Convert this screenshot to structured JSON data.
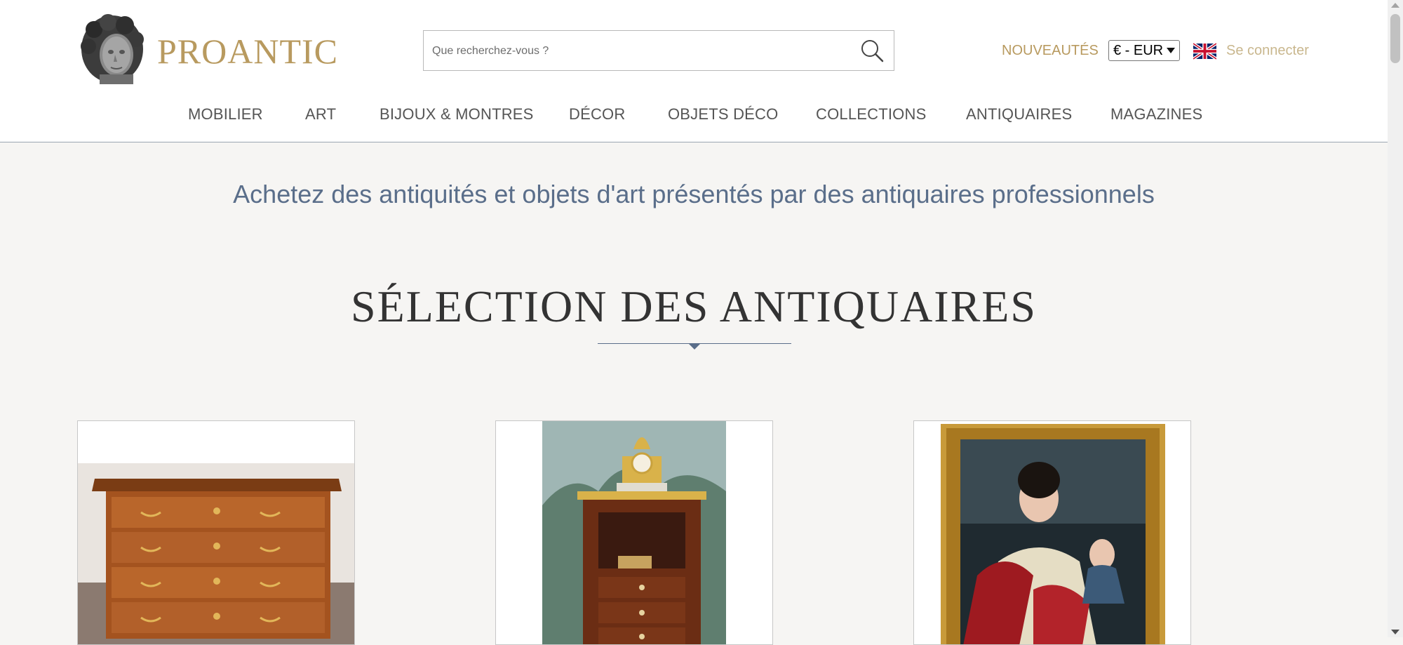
{
  "header": {
    "logo_text": "PROANTIC",
    "search": {
      "placeholder": "Que recherchez-vous ?",
      "value": ""
    },
    "nouveautes_label": "NOUVEAUTÉS",
    "currency_selected": "€ - EUR",
    "login_label": "Se connecter",
    "colors": {
      "gold": "#b89a5f",
      "login": "#c9b78e",
      "nav_text": "#555555"
    }
  },
  "nav": {
    "items": [
      {
        "label": "MOBILIER"
      },
      {
        "label": "ART"
      },
      {
        "label": "BIJOUX & MONTRES"
      },
      {
        "label": "DÉCOR"
      },
      {
        "label": "OBJETS DÉCO"
      },
      {
        "label": "COLLECTIONS"
      },
      {
        "label": "ANTIQUAIRES"
      },
      {
        "label": "MAGAZINES"
      }
    ]
  },
  "main": {
    "tagline": "Achetez des antiquités et objets d'art présentés par des antiquaires professionnels",
    "section_title": "SÉLECTION DES ANTIQUAIRES",
    "accent_color": "#5a6e8a",
    "cards": [
      {
        "image": "marquetry-chest-of-drawers"
      },
      {
        "image": "mahogany-cabinet-with-gilt-clock"
      },
      {
        "image": "portrait-painting-gilt-frame"
      }
    ]
  },
  "icons": {
    "search": "search-icon",
    "flag": "uk-flag-icon",
    "logo": "bust-logo-icon"
  }
}
